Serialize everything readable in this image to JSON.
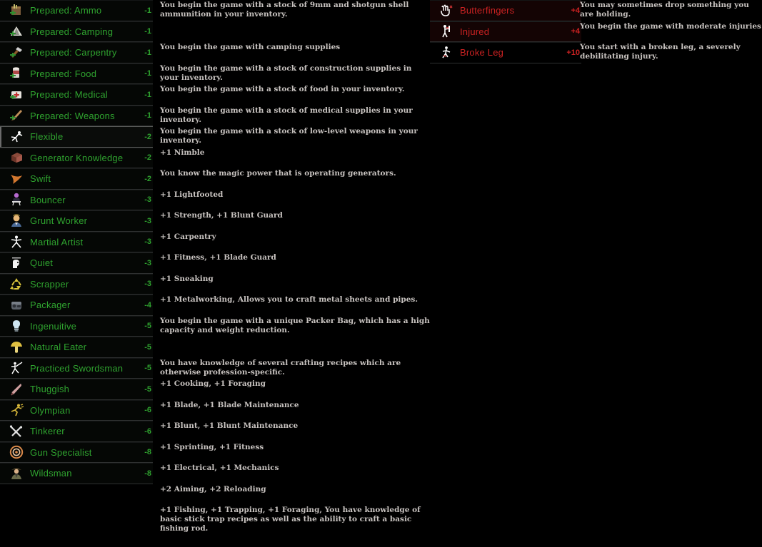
{
  "theme": {
    "background": "#000000",
    "positive_color": "#2fa32f",
    "negative_color": "#cc2222",
    "description_color": "#c8c3c0",
    "separator_color": "#2e3030"
  },
  "positive_traits": [
    {
      "icon": "ammo-box-icon",
      "name": "Prepared: Ammo",
      "cost": "-1",
      "desc": "You begin the game with a stock of 9mm and shotgun shell ammunition in your inventory.",
      "tall": true,
      "selected": false
    },
    {
      "icon": "camping-tent-icon",
      "name": "Prepared: Camping",
      "cost": "-1",
      "desc": "You begin the game with camping supplies",
      "tall": false,
      "selected": false
    },
    {
      "icon": "hammer-icon",
      "name": "Prepared: Carpentry",
      "cost": "-1",
      "desc": "You begin the game with a stock of construction supplies in your inventory.",
      "tall": false,
      "selected": false
    },
    {
      "icon": "food-can-icon",
      "name": "Prepared: Food",
      "cost": "-1",
      "desc": "You begin the game with a stock of food in your inventory.",
      "tall": false,
      "selected": false
    },
    {
      "icon": "medical-kit-icon",
      "name": "Prepared: Medical",
      "cost": "-1",
      "desc": "You begin the game with a stock of medical supplies in your inventory.",
      "tall": false,
      "selected": false
    },
    {
      "icon": "baseball-bat-icon",
      "name": "Prepared: Weapons",
      "cost": "-1",
      "desc": "You begin the game with a stock of low-level weapons in your inventory.",
      "tall": false,
      "selected": false
    },
    {
      "icon": "nimble-figure-icon",
      "name": "Flexible",
      "cost": "-2",
      "desc": "+1 Nimble",
      "tall": false,
      "selected": true
    },
    {
      "icon": "generator-icon",
      "name": "Generator Knowledge",
      "cost": "-2",
      "desc": "You know the magic power that is operating generators.",
      "tall": false,
      "selected": false
    },
    {
      "icon": "swallow-bird-icon",
      "name": "Swift",
      "cost": "-2",
      "desc": "+1 Lightfooted",
      "tall": false,
      "selected": false
    },
    {
      "icon": "bouncer-icon",
      "name": "Bouncer",
      "cost": "-3",
      "desc": "+1 Strength, +1 Blunt Guard",
      "tall": false,
      "selected": false
    },
    {
      "icon": "worker-portrait-icon",
      "name": "Grunt Worker",
      "cost": "-3",
      "desc": "+1 Carpentry",
      "tall": false,
      "selected": false
    },
    {
      "icon": "martial-artist-icon",
      "name": "Martial Artist",
      "cost": "-3",
      "desc": "+1 Fitness, +1 Blade Guard",
      "tall": false,
      "selected": false
    },
    {
      "icon": "sneaking-icon",
      "name": "Quiet",
      "cost": "-3",
      "desc": "+1 Sneaking",
      "tall": false,
      "selected": false
    },
    {
      "icon": "recycle-icon",
      "name": "Scrapper",
      "cost": "-3",
      "desc": "+1 Metalworking, Allows you to craft metal sheets and pipes.",
      "tall": false,
      "selected": false
    },
    {
      "icon": "backpack-icon",
      "name": "Packager",
      "cost": "-4",
      "desc": "You begin the game with a unique Packer Bag, which has a high capacity and weight reduction.",
      "tall": true,
      "selected": false
    },
    {
      "icon": "lightbulb-icon",
      "name": "Ingenuitive",
      "cost": "-5",
      "desc": "You have knowledge of several crafting recipes which are otherwise profession-specific.",
      "tall": false,
      "selected": false
    },
    {
      "icon": "mushroom-icon",
      "name": "Natural Eater",
      "cost": "-5",
      "desc": "+1 Cooking, +1 Foraging",
      "tall": false,
      "selected": false
    },
    {
      "icon": "swordsman-icon",
      "name": "Practiced Swordsman",
      "cost": "-5",
      "desc": "+1 Blade, +1 Blade Maintenance",
      "tall": false,
      "selected": false
    },
    {
      "icon": "blunt-club-icon",
      "name": "Thuggish",
      "cost": "-5",
      "desc": "+1 Blunt, +1 Blunt Maintenance",
      "tall": false,
      "selected": false
    },
    {
      "icon": "runner-icon",
      "name": "Olympian",
      "cost": "-6",
      "desc": "+1 Sprinting, +1 Fitness",
      "tall": false,
      "selected": false
    },
    {
      "icon": "wrench-tools-icon",
      "name": "Tinkerer",
      "cost": "-6",
      "desc": "+1 Electrical, +1 Mechanics",
      "tall": false,
      "selected": false
    },
    {
      "icon": "target-scope-icon",
      "name": "Gun Specialist",
      "cost": "-8",
      "desc": "+2 Aiming, +2 Reloading",
      "tall": false,
      "selected": false
    },
    {
      "icon": "wildsman-icon",
      "name": "Wildsman",
      "cost": "-8",
      "desc": "+1 Fishing, +1 Trapping, +1 Foraging, You have knowledge of basic stick trap recipes as well as the ability to craft a basic fishing rod.",
      "tall": true,
      "selected": false
    }
  ],
  "negative_traits": [
    {
      "icon": "dropping-hands-icon",
      "name": "Butterfingers",
      "cost": "+4",
      "desc": "You may sometimes drop something you are holding.",
      "tinted": true,
      "selected": false
    },
    {
      "icon": "injured-person-icon",
      "name": "Injured",
      "cost": "+4",
      "desc": "You begin the game with moderate injuries",
      "tinted": true,
      "selected": false
    },
    {
      "icon": "broken-leg-icon",
      "name": "Broke Leg",
      "cost": "+10",
      "desc": "You start with a broken leg, a severely debilitating injury.",
      "tinted": false,
      "selected": false
    }
  ]
}
